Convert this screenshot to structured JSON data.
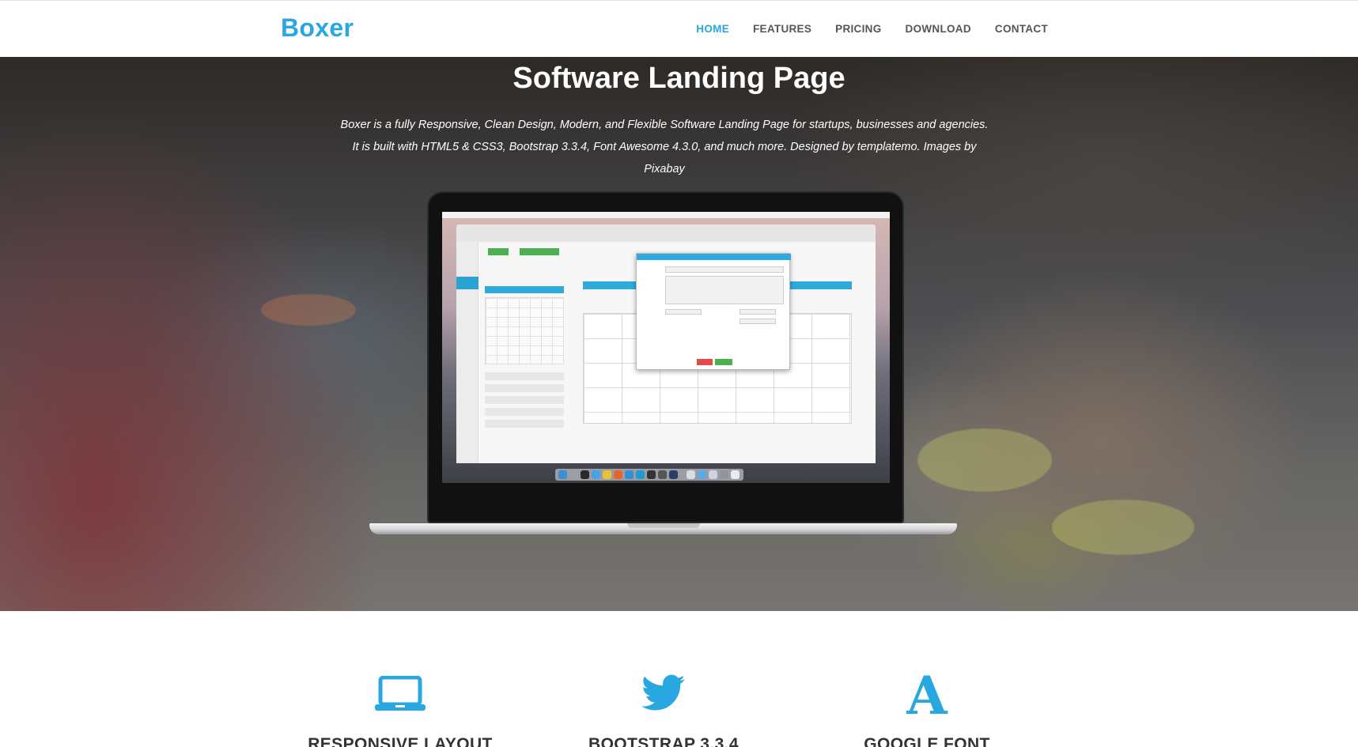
{
  "navbar": {
    "brand": "Boxer",
    "links": [
      {
        "label": "HOME",
        "active": true
      },
      {
        "label": "FEATURES",
        "active": false
      },
      {
        "label": "PRICING",
        "active": false
      },
      {
        "label": "DOWNLOAD",
        "active": false
      },
      {
        "label": "CONTACT",
        "active": false
      }
    ]
  },
  "hero": {
    "title": "Software Landing Page",
    "description": "Boxer is a fully Responsive, Clean Design, Modern, and Flexible Software Landing Page for startups, businesses and agencies. It is built with HTML5 & CSS3, Bootstrap 3.3.4, Font Awesome 4.3.0, and much more. Designed by templatemo. Images by Pixabay",
    "image": "laptop-mockup"
  },
  "features": [
    {
      "icon": "laptop-icon",
      "title": "RESPONSIVE LAYOUT"
    },
    {
      "icon": "twitter-bird-icon",
      "title": "BOOTSTRAP 3.3.4"
    },
    {
      "icon": "font-letter-a-icon",
      "glyph": "A",
      "title": "GOOGLE FONT"
    }
  ],
  "colors": {
    "accent": "#28a7e0",
    "nav_text": "#555555",
    "feature_title": "#333333"
  }
}
